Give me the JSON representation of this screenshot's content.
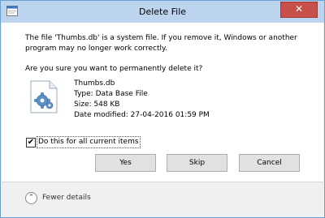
{
  "window": {
    "title": "Delete File",
    "close_glyph": "✕"
  },
  "message": {
    "line1": "The file 'Thumbs.db' is a system file. If you remove it, Windows or another",
    "line2": "program may no longer work correctly.",
    "question": "Are you sure you want to permanently delete it?"
  },
  "file": {
    "icon": "system-file-gear-icon",
    "name": "Thumbs.db",
    "type": "Type: Data Base File",
    "size": "Size: 548 KB",
    "modified": "Date modified: 27-04-2016 01:59 PM"
  },
  "options": {
    "apply_all_checked": true,
    "apply_all_glyph": "✔",
    "apply_all_label": "Do this for all current items"
  },
  "buttons": {
    "yes": "Yes",
    "skip": "Skip",
    "cancel": "Cancel"
  },
  "footer": {
    "toggle_icon": "chevron-up-circle-icon",
    "toggle_glyph": "⌃",
    "toggle_label": "Fewer details"
  },
  "colors": {
    "titlebar": "#bcd4ee",
    "close_button": "#c7504a",
    "dialog_body": "#ffffff",
    "footer": "#f0f0f0"
  }
}
